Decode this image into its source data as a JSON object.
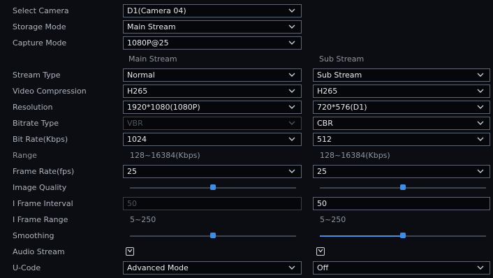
{
  "select_camera": {
    "label": "Select Camera",
    "value": "D1(Camera 04)"
  },
  "storage_mode": {
    "label": "Storage Mode",
    "value": "Main Stream"
  },
  "capture_mode": {
    "label": "Capture Mode",
    "value": "1080P@25"
  },
  "columns": {
    "main": "Main Stream",
    "sub": "Sub Stream"
  },
  "stream_type": {
    "label": "Stream Type",
    "main": "Normal",
    "sub": "Sub Stream"
  },
  "video_compression": {
    "label": "Video Compression",
    "main": "H265",
    "sub": "H265"
  },
  "resolution": {
    "label": "Resolution",
    "main": "1920*1080(1080P)",
    "sub": "720*576(D1)"
  },
  "bitrate_type": {
    "label": "Bitrate Type",
    "main": "VBR",
    "sub": "CBR"
  },
  "bit_rate": {
    "label": "Bit Rate(Kbps)",
    "main": "1024",
    "sub": "512"
  },
  "range": {
    "label": "Range",
    "main": "128~16384(Kbps)",
    "sub": "128~16384(Kbps)"
  },
  "frame_rate": {
    "label": "Frame Rate(fps)",
    "main": "25",
    "sub": "25"
  },
  "image_quality": {
    "label": "Image Quality",
    "main_level": 0.5,
    "sub_level": 0.5
  },
  "i_frame_interval": {
    "label": "I Frame Interval",
    "main": "50",
    "sub": "50"
  },
  "i_frame_range": {
    "label": "I Frame Range",
    "main": "5~250",
    "sub": "5~250"
  },
  "smoothing": {
    "label": "Smoothing",
    "main_level": 0.5,
    "sub_level": 0.5
  },
  "audio_stream": {
    "label": "Audio Stream",
    "main_checked": true,
    "sub_checked": true
  },
  "u_code": {
    "label": "U-Code",
    "main": "Advanced Mode",
    "sub": "Off"
  },
  "icons": {
    "dropdown": "chevron-down-icon",
    "checkbox": "checkbox-checked-icon"
  },
  "colors": {
    "accent": "#3b8fe8",
    "background": "#0b0d13"
  }
}
